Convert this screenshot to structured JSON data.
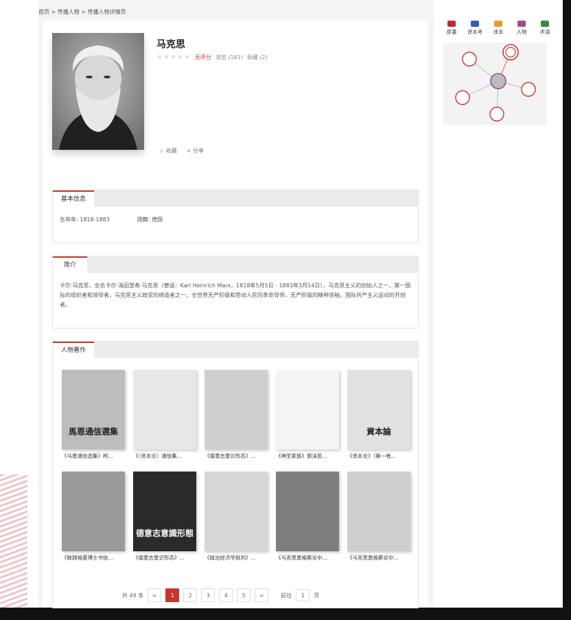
{
  "breadcrumb": "首页 > 传播人物 > 传播人物详情页",
  "profile": {
    "name": "马克思",
    "stars": "★★★★★",
    "rating": "无评分",
    "views": "浏览 (161)",
    "favorites": "收藏 (2)",
    "action_favorite": "☆ 收藏",
    "action_share": "< 分享"
  },
  "basic": {
    "title": "基本信息",
    "lifespan": "生卒年:  1818-1883",
    "nationality": "国籍:  德国"
  },
  "intro": {
    "title": "简介",
    "text": "卡尔·马克思，全名卡尔·海因里希·马克思（德语：Karl Heinrich Marx，1818年5月5日 - 1883年3月14日），马克思主义的创始人之一，第一国际的组织者和领导者，马克思主义政党的缔造者之一，全世界无产阶级和劳动人民的革命导师，无产阶级的精神领袖，国际共产主义运动的开创者。"
  },
  "works": {
    "title": "人物著作",
    "items": [
      {
        "caption": "《马恩通信选集》柯...",
        "cover_text": "馬恩通信選集",
        "tone": "#bdbdbd"
      },
      {
        "caption": "《〈资本论〉通信集...",
        "cover_text": "",
        "tone": "#e7e7e5"
      },
      {
        "caption": "《德意志意识形态》...",
        "cover_text": "",
        "tone": "#cfcfcf"
      },
      {
        "caption": "《神圣家族》郭沫若...",
        "cover_text": "",
        "tone": "#f4f4f4"
      },
      {
        "caption": "《资本论》（第一卷...",
        "cover_text": "資本論",
        "tone": "#e2e2e2"
      },
      {
        "caption": "《致顾格曼博士书信...",
        "cover_text": "",
        "tone": "#9a9a9a"
      },
      {
        "caption": "《德意志意识形态》...",
        "cover_text": "德意志意識形態",
        "tone": "#2a2a2a"
      },
      {
        "caption": "《政治经济学批判》...",
        "cover_text": "",
        "tone": "#d7d7d7"
      },
      {
        "caption": "《马克思恩格斯论中...",
        "cover_text": "",
        "tone": "#7e7e7e"
      },
      {
        "caption": "《马克思恩格斯论中...",
        "cover_text": "",
        "tone": "#cfcfcf"
      }
    ]
  },
  "pagination": {
    "total": "共 49 条",
    "prev": "<",
    "pages": [
      "1",
      "2",
      "3",
      "4",
      "5"
    ],
    "next": ">",
    "goto_label": "前往",
    "goto_value": "1",
    "goto_suffix": "页"
  },
  "legend": [
    {
      "label": "原著",
      "color": "#c0283a"
    },
    {
      "label": "译本考",
      "color": "#2f5fb0"
    },
    {
      "label": "译本",
      "color": "#ee9a2a"
    },
    {
      "label": "人物",
      "color": "#a04a8e"
    },
    {
      "label": "术语",
      "color": "#3d8a3b"
    }
  ],
  "colors": {
    "accent": "#c7352d"
  }
}
